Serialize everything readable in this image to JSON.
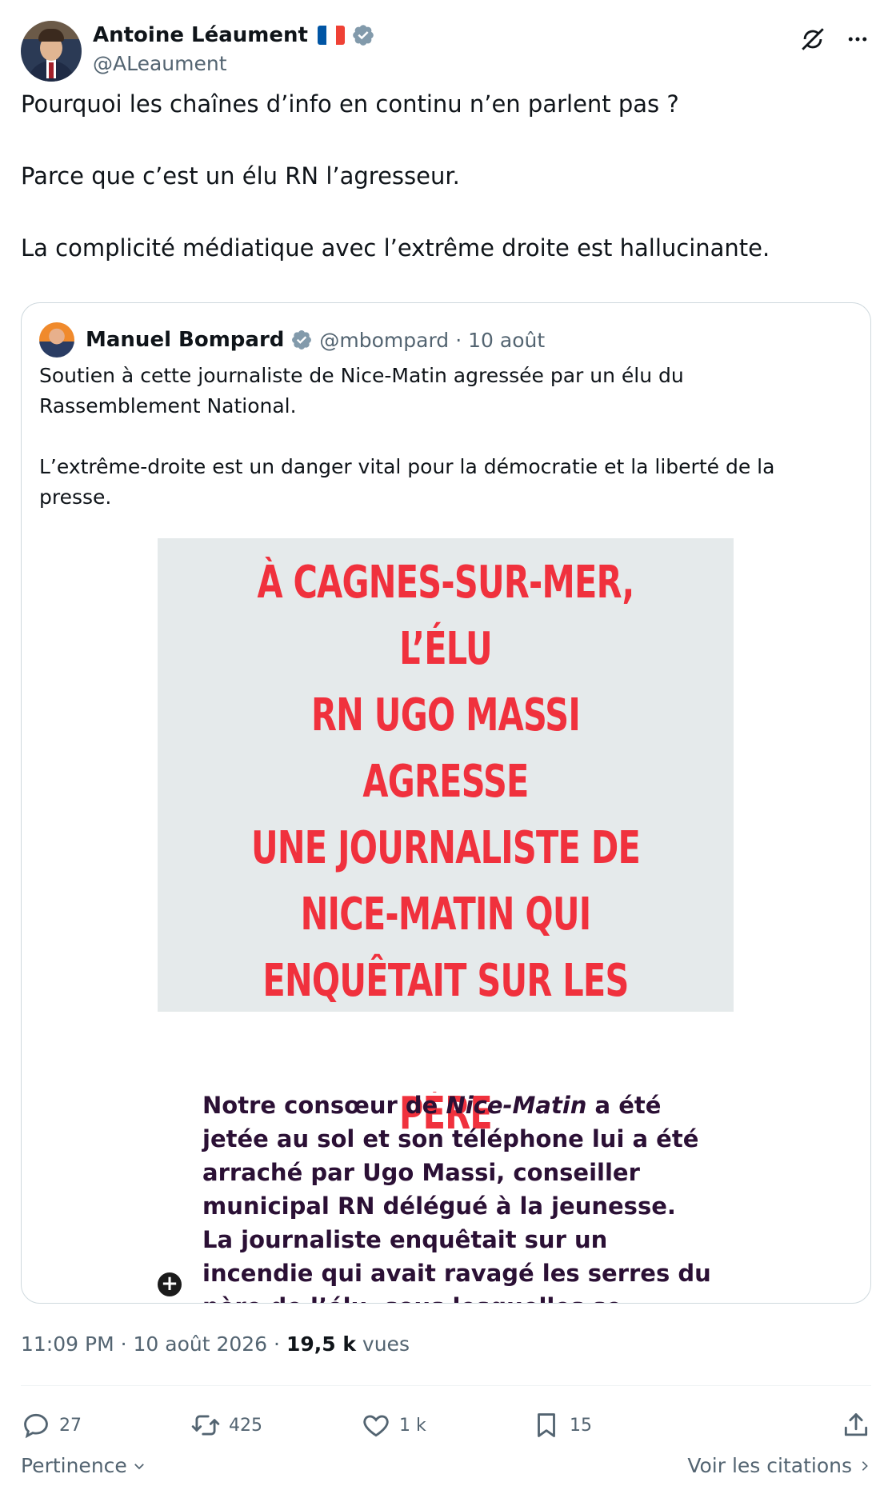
{
  "author": {
    "display_name": "Antoine Léaument",
    "handle": "@ALeaument",
    "flag_icon": "flag-france-icon",
    "verified_icon": "verified-badge-icon"
  },
  "tweet_text": "Pourquoi les chaînes d’info en continu n’en parlent pas ?\n\nParce que c’est un élu RN l’agresseur.\n\nLa complicité médiatique avec l’extrême droite est hallucinante.",
  "quoted": {
    "display_name": "Manuel Bompard",
    "handle": "@mbompard",
    "separator": "·",
    "date": "10 août",
    "text": "Soutien à cette journaliste de Nice-Matin agressée par un élu du Rassemblement National.\n\nL’extrême-droite est un danger vital pour la démocratie et la liberté de la presse.",
    "image": {
      "headline": "À CAGNES-SUR-MER, L’ÉLU\nRN UGO MASSI AGRESSE\nUNE JOURNALISTE DE\nNICE-MATIN QUI\nENQUÊTAIT SUR LES\nACTIVITÉS DE SON PÈRE",
      "body_prefix": "Notre consœur de ",
      "body_italic": "Nice-Matin",
      "body_rest": " a été jetée au sol et son téléphone lui a été arraché par Ugo Massi, conseiller municipal RN délégué à la jeunesse. La journaliste enquêtait sur un incendie qui avait ravagé les serres du père de l’élu, sous lesquelles se tenaient des",
      "plus_glyph": "+"
    }
  },
  "meta": {
    "time": "11:09 PM",
    "sep1": "·",
    "date": "10 août 2026",
    "sep2": "·",
    "views_count": "19,5 k",
    "views_label": "vues"
  },
  "actions": {
    "replies": "27",
    "reposts": "425",
    "likes": "1 k",
    "bookmarks": "15"
  },
  "footer": {
    "sort_label": "Pertinence",
    "quotes_link": "Voir les citations"
  },
  "colors": {
    "headline_red": "#f0313d",
    "poster_bg": "#e5eaeb",
    "body_purple": "#2b1035",
    "verified_blue": "#829aab",
    "secondary_text": "#536471"
  }
}
